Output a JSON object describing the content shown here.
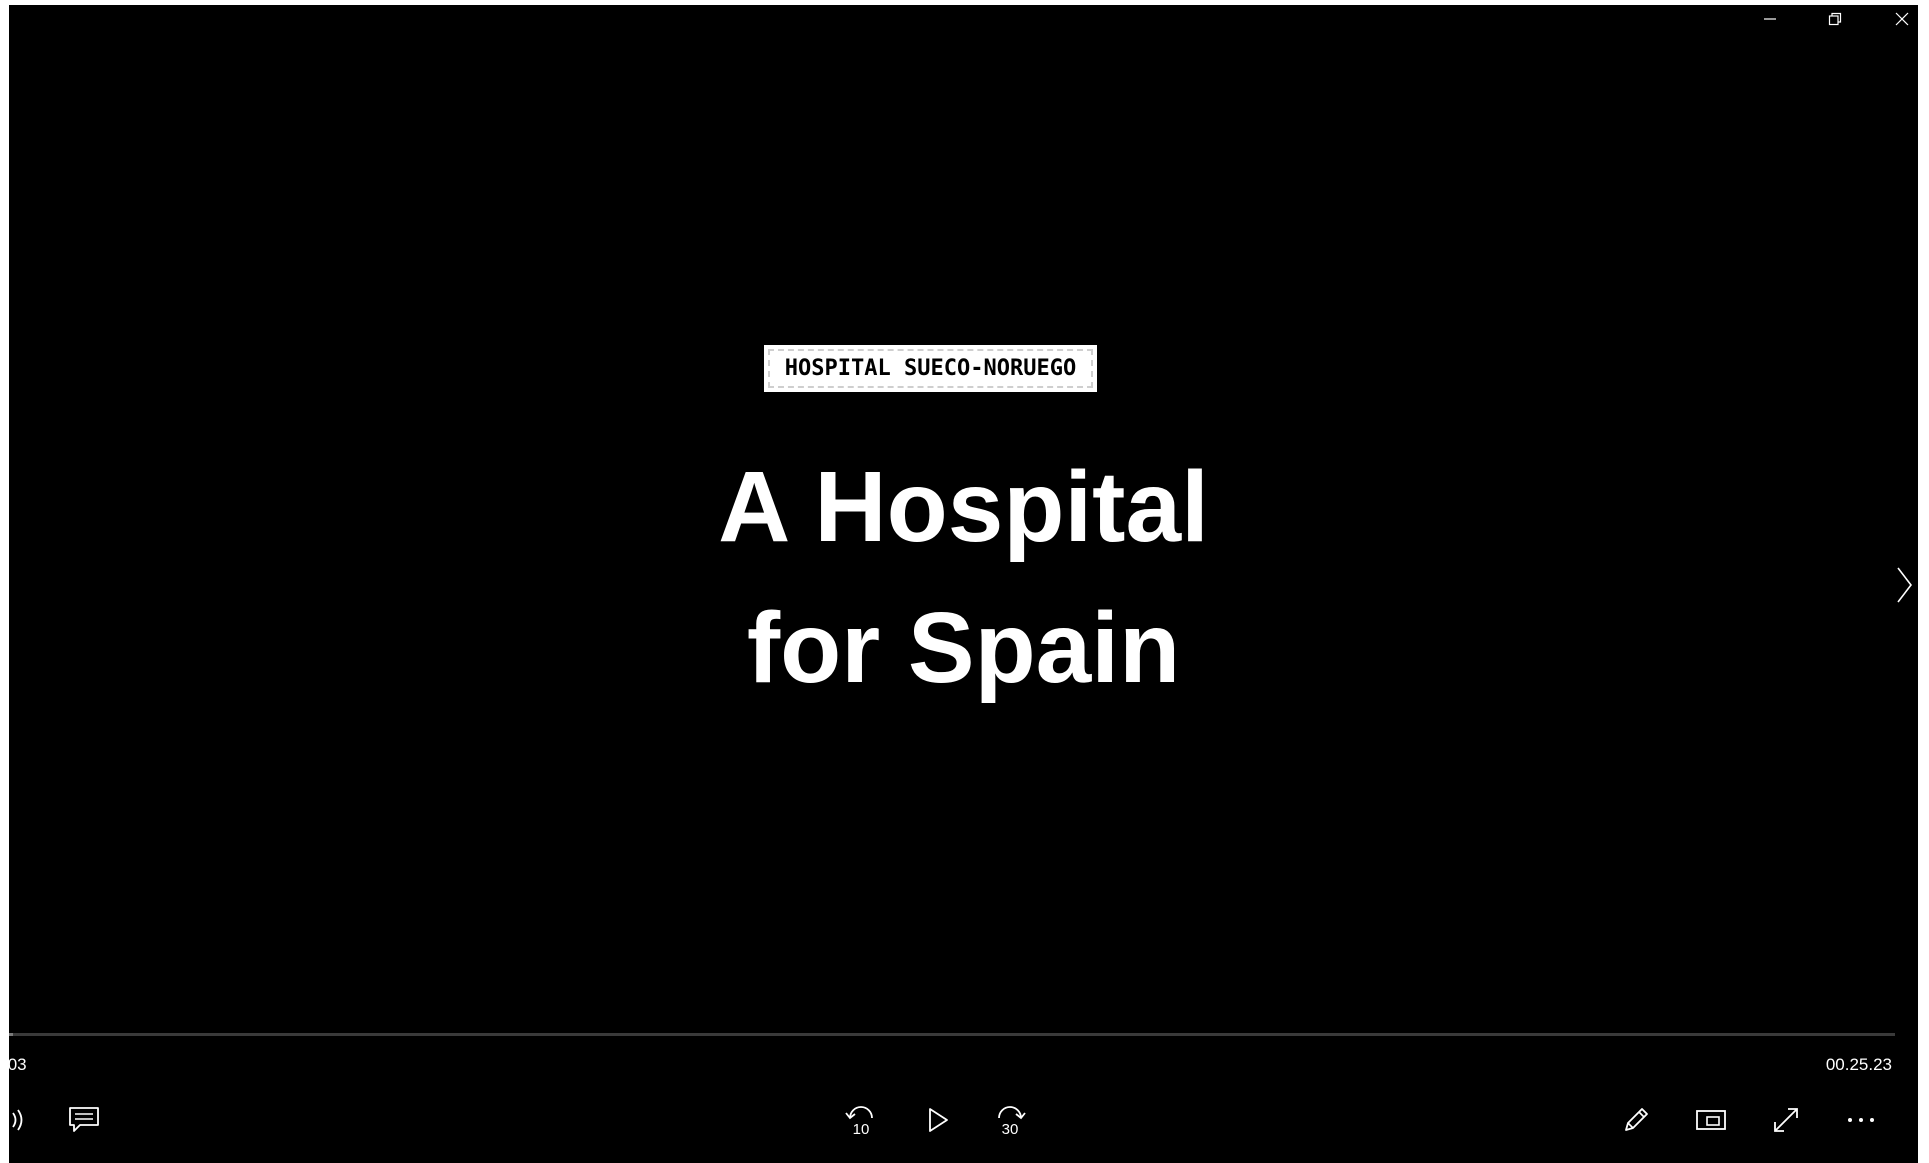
{
  "window": {
    "minimize_icon": "minimize-icon",
    "restore_icon": "restore-icon",
    "close_icon": "close-icon"
  },
  "video": {
    "stamp_text": "HOSPITAL SUECO-NORUEGO",
    "title_line_1": "A Hospital",
    "title_line_2": "for Spain"
  },
  "player": {
    "elapsed_time": ".03",
    "total_time": "00.25.23",
    "progress_fraction": 0.002,
    "skip_back_label": "10",
    "skip_forward_label": "30",
    "icons": {
      "volume": "volume-icon",
      "subtitles": "subtitles-icon",
      "skip_back": "skip-back-10-icon",
      "play": "play-icon",
      "skip_forward": "skip-forward-30-icon",
      "edit": "pencil-icon",
      "mini_view": "mini-view-icon",
      "fullscreen": "fullscreen-icon",
      "more": "more-options-icon",
      "next": "chevron-right-icon"
    }
  },
  "colors": {
    "background": "#000000",
    "foreground": "#ffffff",
    "track": "#3a3a3a"
  }
}
